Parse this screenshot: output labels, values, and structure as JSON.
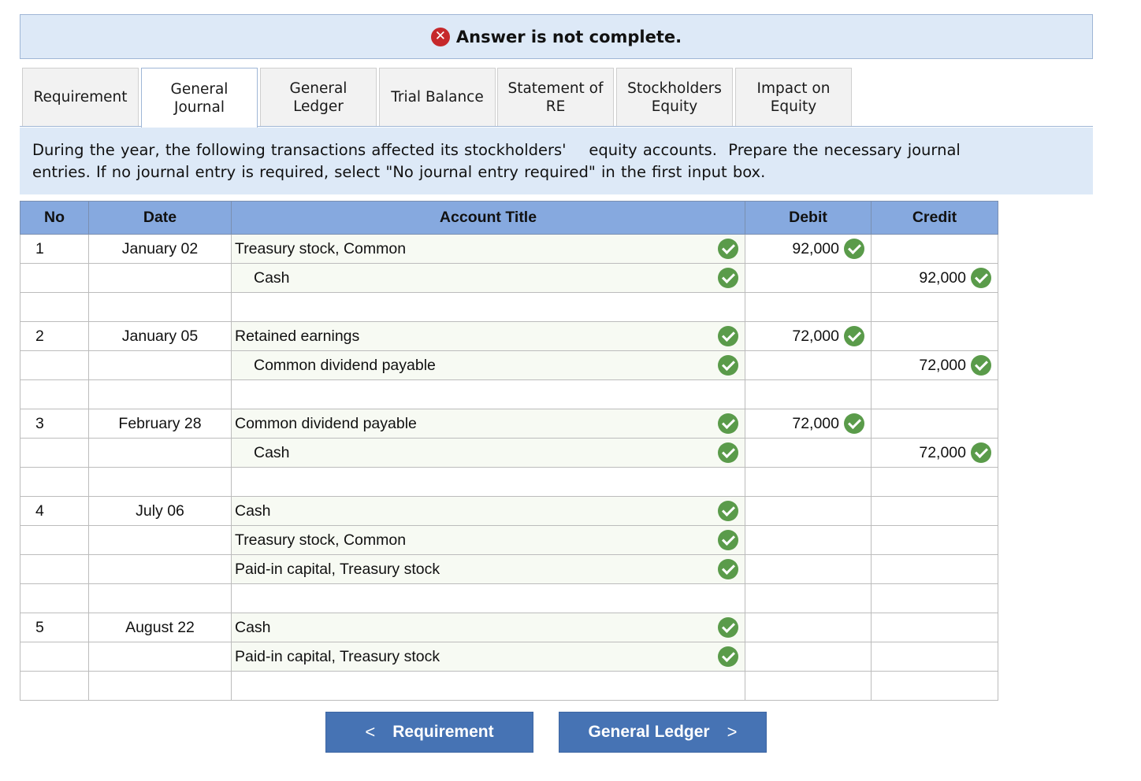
{
  "banner": {
    "text": "Answer is not complete.",
    "icon": "x-circle-icon",
    "icon_color": "#c6282b"
  },
  "tabs": [
    {
      "line1": "Requirement",
      "line2": "",
      "active": false
    },
    {
      "line1": "General",
      "line2": "Journal",
      "active": true
    },
    {
      "line1": "General",
      "line2": "Ledger",
      "active": false
    },
    {
      "line1": "Trial Balance",
      "line2": "",
      "active": false
    },
    {
      "line1": "Statement of",
      "line2": "RE",
      "active": false
    },
    {
      "line1": "Stockholders",
      "line2": "Equity",
      "active": false
    },
    {
      "line1": "Impact on",
      "line2": "Equity",
      "active": false
    }
  ],
  "instructions": {
    "line1": "During the year, the following transactions affected its stockholders'    equity accounts.  Prepare the necessary journal",
    "line2": "entries.  If no journal entry is required, select \"No journal entry required\" in the first input box."
  },
  "table": {
    "headers": {
      "no": "No",
      "date": "Date",
      "account": "Account Title",
      "debit": "Debit",
      "credit": "Credit"
    },
    "header_color": "#86a9df",
    "check_color": "#5a9b4a",
    "rows": [
      {
        "no": "1",
        "date": "January 02",
        "account": "Treasury stock, Common",
        "indent": false,
        "acct_check": true,
        "debit": "92,000",
        "debit_check": true,
        "credit": "",
        "credit_check": false
      },
      {
        "no": "",
        "date": "",
        "account": "Cash",
        "indent": true,
        "acct_check": true,
        "debit": "",
        "debit_check": false,
        "credit": "92,000",
        "credit_check": true
      },
      {
        "no": "",
        "date": "",
        "account": "",
        "indent": false,
        "acct_check": false,
        "debit": "",
        "debit_check": false,
        "credit": "",
        "credit_check": false
      },
      {
        "no": "2",
        "date": "January 05",
        "account": "Retained earnings",
        "indent": false,
        "acct_check": true,
        "debit": "72,000",
        "debit_check": true,
        "credit": "",
        "credit_check": false
      },
      {
        "no": "",
        "date": "",
        "account": "Common dividend payable",
        "indent": true,
        "acct_check": true,
        "debit": "",
        "debit_check": false,
        "credit": "72,000",
        "credit_check": true
      },
      {
        "no": "",
        "date": "",
        "account": "",
        "indent": false,
        "acct_check": false,
        "debit": "",
        "debit_check": false,
        "credit": "",
        "credit_check": false
      },
      {
        "no": "3",
        "date": "February 28",
        "account": "Common dividend payable",
        "indent": false,
        "acct_check": true,
        "debit": "72,000",
        "debit_check": true,
        "credit": "",
        "credit_check": false
      },
      {
        "no": "",
        "date": "",
        "account": "Cash",
        "indent": true,
        "acct_check": true,
        "debit": "",
        "debit_check": false,
        "credit": "72,000",
        "credit_check": true
      },
      {
        "no": "",
        "date": "",
        "account": "",
        "indent": false,
        "acct_check": false,
        "debit": "",
        "debit_check": false,
        "credit": "",
        "credit_check": false
      },
      {
        "no": "4",
        "date": "July 06",
        "account": "Cash",
        "indent": false,
        "acct_check": true,
        "debit": "",
        "debit_check": false,
        "credit": "",
        "credit_check": false
      },
      {
        "no": "",
        "date": "",
        "account": "Treasury stock, Common",
        "indent": false,
        "acct_check": true,
        "debit": "",
        "debit_check": false,
        "credit": "",
        "credit_check": false
      },
      {
        "no": "",
        "date": "",
        "account": "Paid-in capital, Treasury stock",
        "indent": false,
        "acct_check": true,
        "debit": "",
        "debit_check": false,
        "credit": "",
        "credit_check": false
      },
      {
        "no": "",
        "date": "",
        "account": "",
        "indent": false,
        "acct_check": false,
        "debit": "",
        "debit_check": false,
        "credit": "",
        "credit_check": false
      },
      {
        "no": "5",
        "date": "August 22",
        "account": "Cash",
        "indent": false,
        "acct_check": true,
        "debit": "",
        "debit_check": false,
        "credit": "",
        "credit_check": false
      },
      {
        "no": "",
        "date": "",
        "account": "Paid-in capital, Treasury stock",
        "indent": false,
        "acct_check": true,
        "debit": "",
        "debit_check": false,
        "credit": "",
        "credit_check": false
      },
      {
        "no": "",
        "date": "",
        "account": "",
        "indent": false,
        "acct_check": false,
        "debit": "",
        "debit_check": false,
        "credit": "",
        "credit_check": false
      }
    ]
  },
  "nav": {
    "prev_label": "Requirement",
    "next_label": "General Ledger",
    "prev_icon": "chevron-left-icon",
    "next_icon": "chevron-right-icon",
    "button_color": "#4673b4"
  }
}
